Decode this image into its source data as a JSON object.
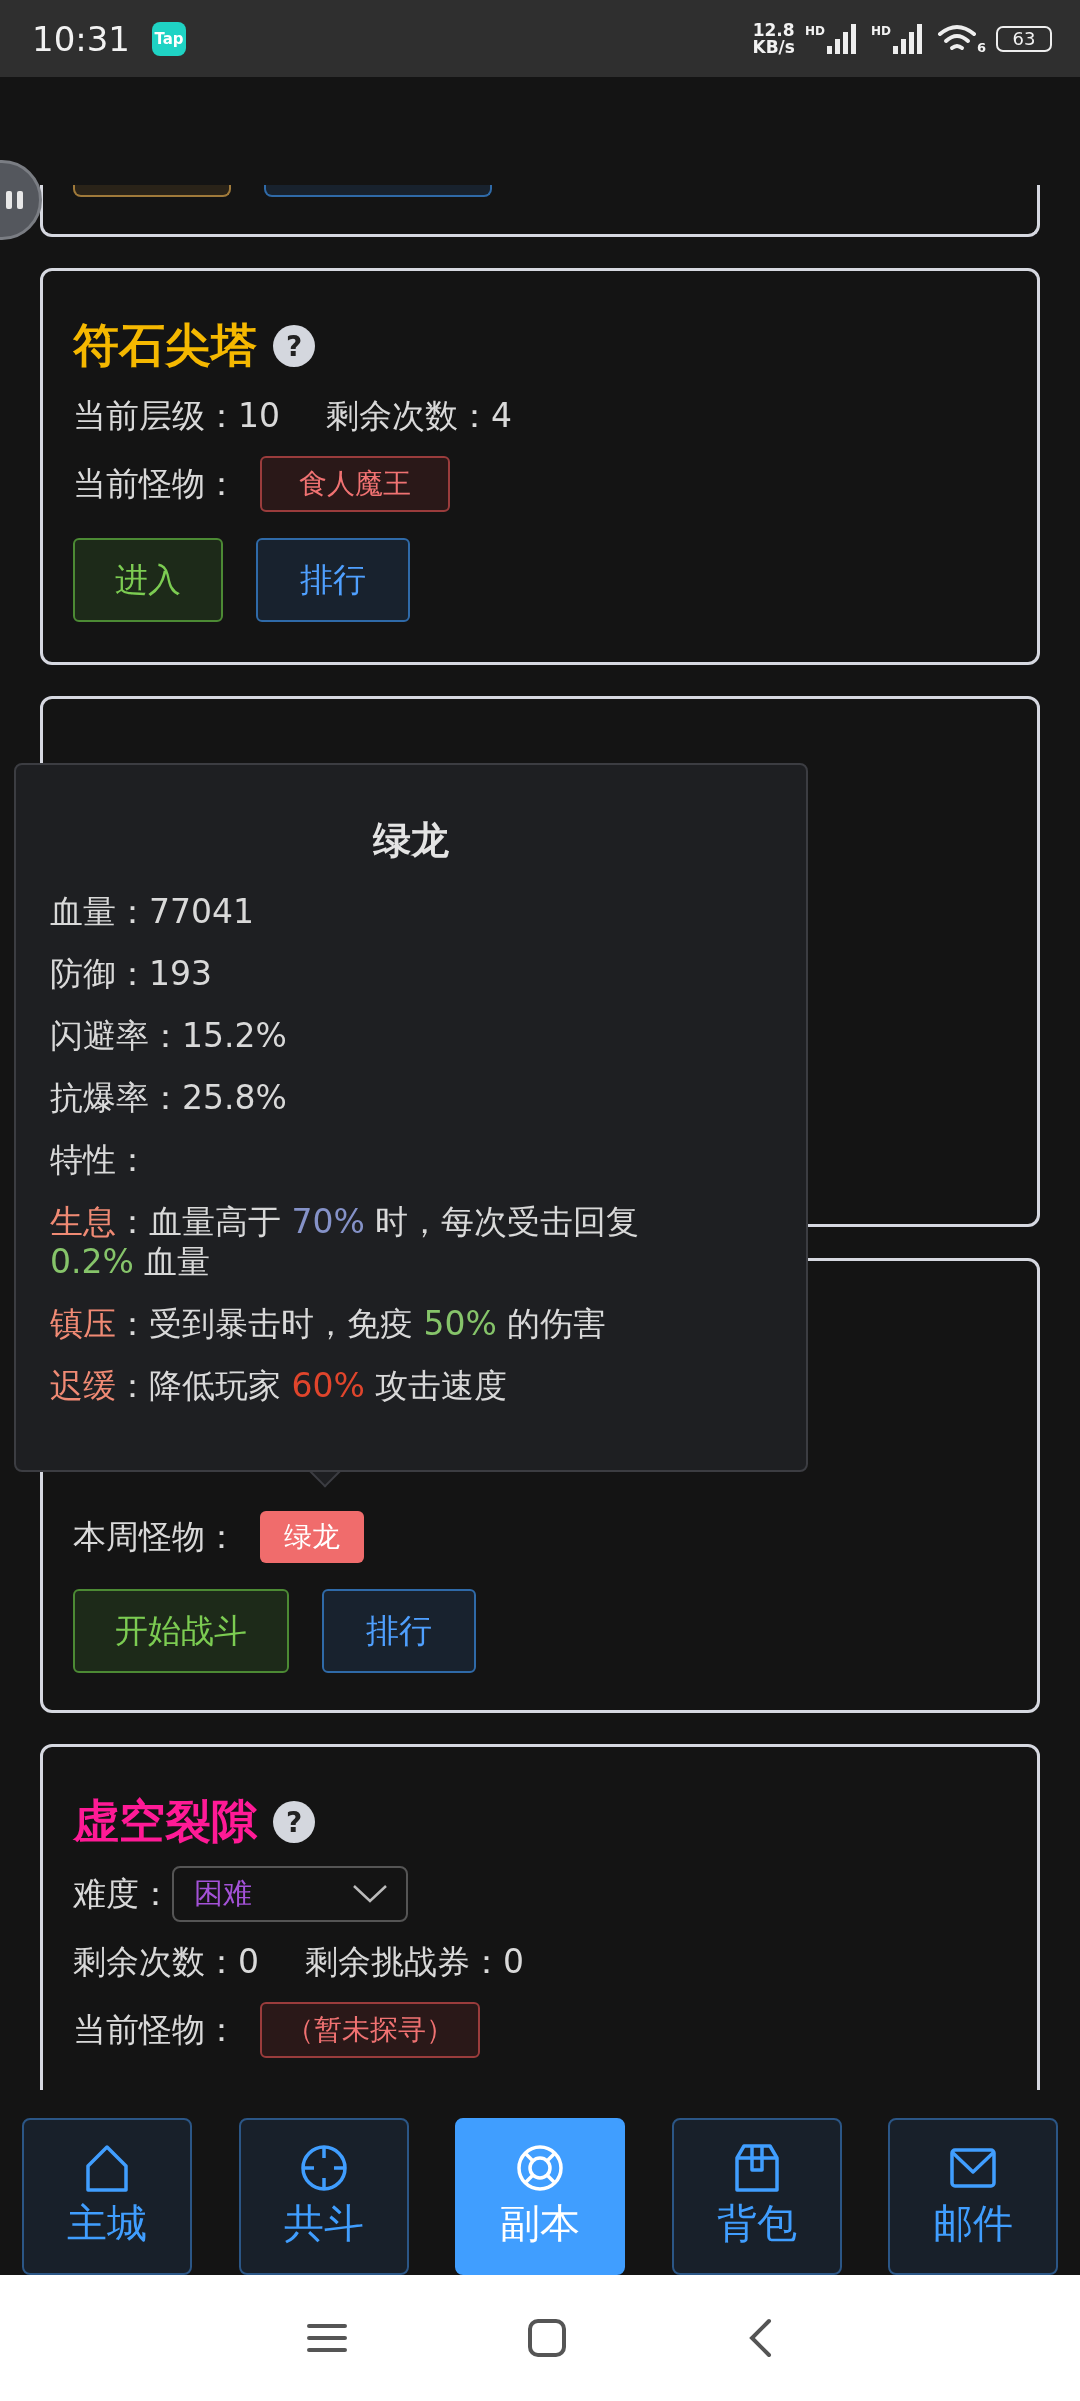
{
  "status_bar": {
    "time": "10:31",
    "app_badge": "Tap",
    "speed": [
      "12.8",
      "KB/s"
    ],
    "signals": [
      "HD",
      "HD"
    ],
    "wifi": "6",
    "battery": "63"
  },
  "cards": [
    {
      "kind": "tail",
      "buttons": [
        {
          "kind": "warning"
        },
        {
          "kind": "primary"
        }
      ]
    },
    {
      "kind": "full",
      "title": "符石尖塔",
      "color": "#f5b800",
      "help": "?",
      "rows": [
        {
          "kind": "text",
          "items": [
            "当前层级：10",
            "剩余次数：4"
          ]
        },
        {
          "kind": "tag",
          "label": "当前怪物：",
          "tag": {
            "text": "食人魔王",
            "kind": "outline"
          }
        }
      ],
      "buttons": [
        {
          "label": "进入",
          "kind": "success"
        },
        {
          "label": "排行",
          "kind": "primary"
        }
      ]
    },
    {
      "kind": "covered"
    },
    {
      "kind": "covered_top",
      "rows": [
        {
          "kind": "tag",
          "label": "本周怪物：",
          "tag": {
            "text": "绿龙",
            "kind": "filled"
          }
        }
      ],
      "buttons": [
        {
          "label": "开始战斗",
          "kind": "success"
        },
        {
          "label": "排行",
          "kind": "primary"
        }
      ]
    },
    {
      "kind": "full",
      "title": "虚空裂隙",
      "color": "#ff1a96",
      "help": "?",
      "rows": [
        {
          "kind": "select",
          "label": "难度：",
          "value": "困难"
        },
        {
          "kind": "text",
          "items": [
            "剩余次数：0",
            "剩余挑战券：0"
          ]
        },
        {
          "kind": "tag",
          "label": "当前怪物：",
          "tag": {
            "text": "（暂未探寻）",
            "kind": "outline"
          }
        }
      ]
    }
  ],
  "tooltip": {
    "title": "绿龙",
    "stats": [
      "血量：77041",
      "防御：193",
      "闪避率：15.2%",
      "抗爆率：25.8%",
      "特性："
    ],
    "traits": [
      {
        "name": "生息",
        "parts": [
          {
            "text": "：血量高于 "
          },
          {
            "text": "70%",
            "color": "#8592c8"
          },
          {
            "text": " 时，每次受击回复 "
          },
          {
            "text": "0.2%",
            "color": "#86c46a"
          },
          {
            "text": " 血量"
          }
        ]
      },
      {
        "name": "镇压",
        "parts": [
          {
            "text": "：受到暴击时，免疫 "
          },
          {
            "text": "50%",
            "color": "#86c46a"
          },
          {
            "text": " 的伤害"
          }
        ]
      },
      {
        "name": "迟缓",
        "parts": [
          {
            "text": "：降低玩家 "
          },
          {
            "text": "60%",
            "color": "#e0452c"
          },
          {
            "text": " 攻击速度"
          }
        ]
      }
    ]
  },
  "nav": [
    {
      "label": "主城",
      "kind": "home",
      "selected": false
    },
    {
      "label": "共斗",
      "kind": "target",
      "selected": false
    },
    {
      "label": "副本",
      "kind": "ring",
      "selected": true
    },
    {
      "label": "背包",
      "kind": "box",
      "selected": false
    },
    {
      "label": "邮件",
      "kind": "mail",
      "selected": false
    }
  ]
}
